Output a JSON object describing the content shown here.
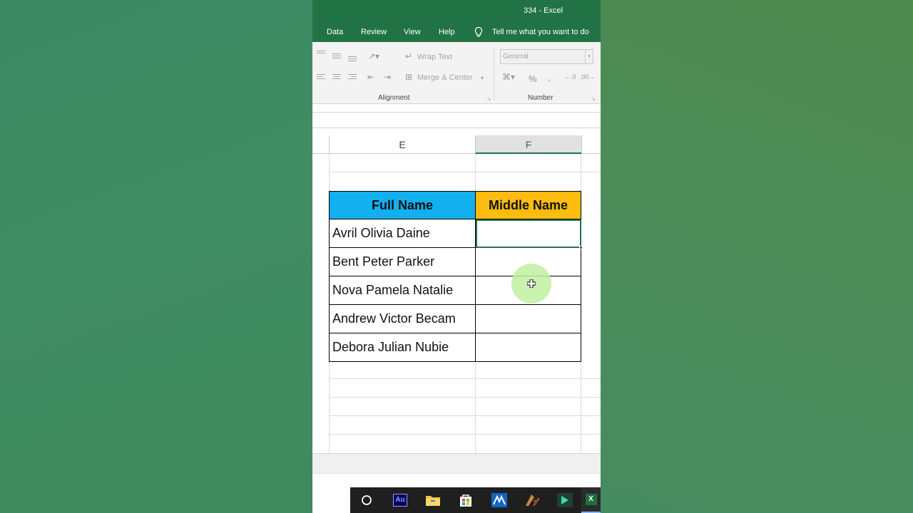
{
  "window": {
    "title": "334  -  Excel"
  },
  "menu": {
    "items": [
      "Data",
      "Review",
      "View",
      "Help"
    ],
    "tell_me": "Tell me what you want to do"
  },
  "ribbon": {
    "wrap_text": "Wrap Text",
    "merge_center": "Merge & Center",
    "number_format": "General",
    "alignment_label": "Alignment",
    "number_label": "Number",
    "percent": "%",
    "comma": ","
  },
  "grid": {
    "columns": [
      "E",
      "F"
    ],
    "selected_column": "F"
  },
  "table": {
    "headers": [
      "Full Name",
      "Middle Name"
    ],
    "rows": [
      [
        "Avril Olivia Daine",
        ""
      ],
      [
        "Bent Peter Parker",
        ""
      ],
      [
        "Nova Pamela Natalie",
        ""
      ],
      [
        "Andrew Victor Becam",
        ""
      ],
      [
        "Debora Julian Nubie",
        ""
      ]
    ],
    "header_colors": {
      "full_name": "#12b0ef",
      "middle_name": "#fdbc0f"
    }
  },
  "taskbar": {
    "apps": [
      "search-icon",
      "audition-icon",
      "file-explorer-icon",
      "store-icon",
      "app-m-icon",
      "app-paint-icon",
      "app-arrow-icon",
      "excel-icon"
    ],
    "audition_label": "Au",
    "excel_label": "X"
  },
  "colors": {
    "excel_green": "#217346",
    "accent_blue": "#12b0ef",
    "accent_orange": "#fdbc0f"
  }
}
